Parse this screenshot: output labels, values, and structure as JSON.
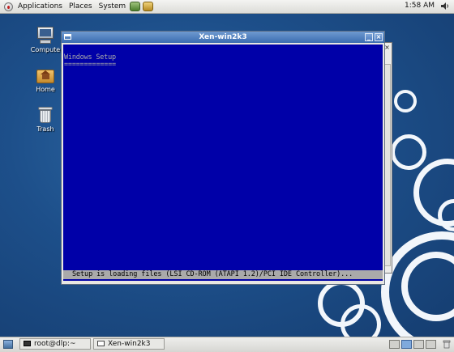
{
  "top_panel": {
    "menus": [
      "Applications",
      "Places",
      "System"
    ],
    "clock": "1:58 AM"
  },
  "desktop": {
    "icons": [
      {
        "label": "Compute"
      },
      {
        "label": "Home"
      },
      {
        "label": "Trash"
      }
    ]
  },
  "window": {
    "title": "Xen-win2k3",
    "minimize_glyph": "_",
    "close_glyph": "×",
    "screen": {
      "heading": "Windows Setup",
      "underline": "=============",
      "status": "Setup is loading files (LSI CD-ROM (ATAPI 1.2)/PCI IDE Controller)..."
    }
  },
  "back_window": {
    "close_glyph": "×"
  },
  "taskbar": {
    "tasks": [
      {
        "label": "root@dlp:~"
      },
      {
        "label": "Xen-win2k3"
      }
    ]
  },
  "colors": {
    "vm_background": "#0000a8",
    "vm_text": "#aaaaaa",
    "status_bar": "#aaaaaa",
    "titlebar": "#3a6cb1"
  }
}
